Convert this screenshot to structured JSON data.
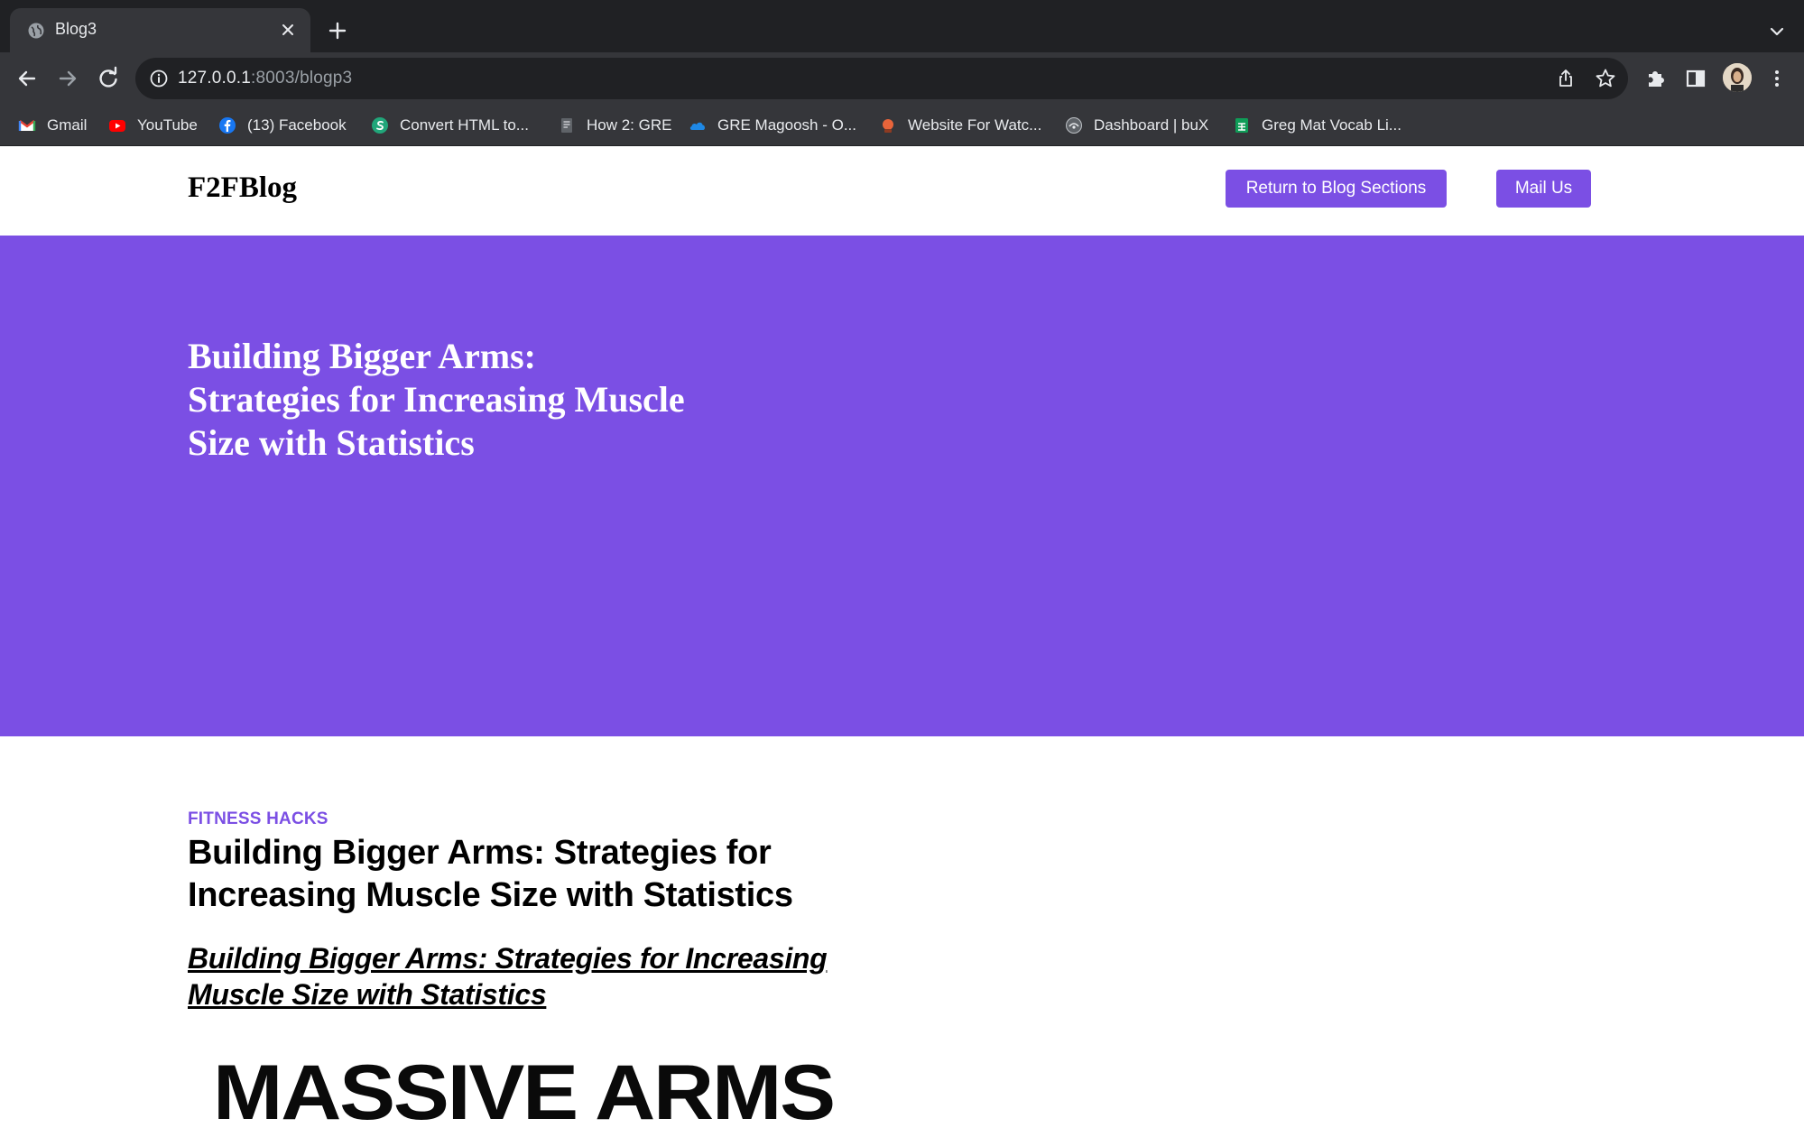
{
  "browser": {
    "tab": {
      "title": "Blog3"
    },
    "address": {
      "host": "127.0.0.1",
      "rest": ":8003/blogp3"
    },
    "bookmarks": [
      {
        "label": "Gmail",
        "icon": "gmail-icon"
      },
      {
        "label": "YouTube",
        "icon": "youtube-icon"
      },
      {
        "label": "(13) Facebook",
        "icon": "facebook-icon"
      },
      {
        "label": "Convert HTML to...",
        "icon": "convert-icon"
      },
      {
        "label": "How 2: GRE",
        "icon": "document-icon"
      },
      {
        "label": "GRE Magoosh - O...",
        "icon": "onedrive-icon"
      },
      {
        "label": "Website For Watc...",
        "icon": "website-icon"
      },
      {
        "label": "Dashboard | buX",
        "icon": "dashboard-icon"
      },
      {
        "label": "Greg Mat Vocab Li...",
        "icon": "sheets-icon"
      }
    ]
  },
  "site": {
    "logo": "F2FBlog",
    "nav": {
      "return_label": "Return to Blog Sections",
      "mail_label": "Mail Us"
    },
    "accent": "#7b4fe4"
  },
  "hero": {
    "title": "Building Bigger Arms: Strategies for Increasing Muscle Size with Statistics"
  },
  "article": {
    "category": "FITNESS HACKS",
    "title": "Building Bigger Arms: Strategies for Increasing Muscle Size with Statistics",
    "link_text": "Building Bigger Arms: Strategies for Increasing Muscle Size with Statistics",
    "image_text": "MASSIVE ARMS"
  }
}
